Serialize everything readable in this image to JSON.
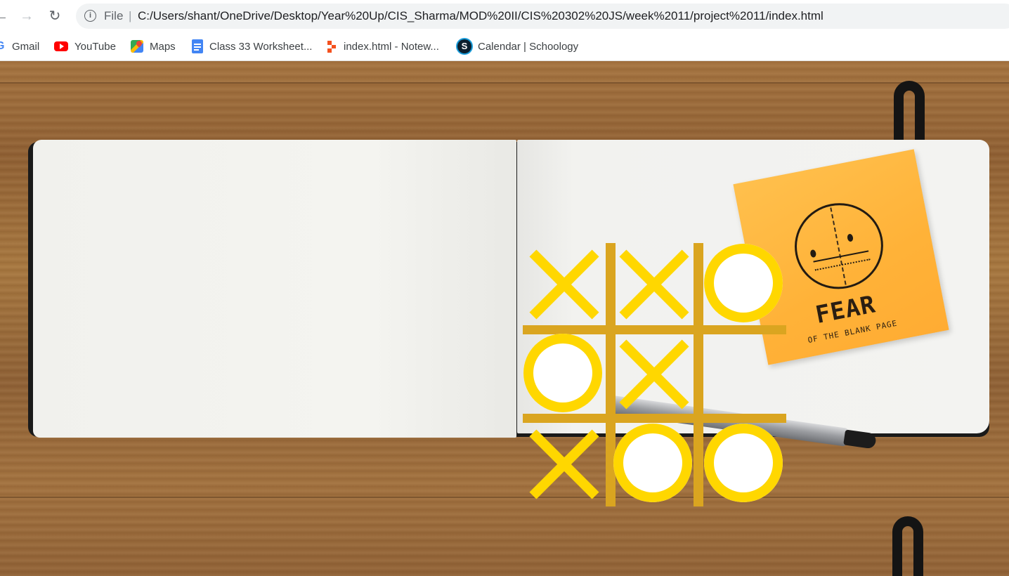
{
  "browser": {
    "url_scheme": "File",
    "url_separator": "|",
    "url": "C:/Users/shant/OneDrive/Desktop/Year%20Up/CIS_Sharma/MOD%20II/CIS%20302%20JS/week%2011/project%2011/index.html"
  },
  "bookmarks": [
    {
      "label": "Gmail",
      "icon": "google-g-icon"
    },
    {
      "label": "YouTube",
      "icon": "youtube-icon"
    },
    {
      "label": "Maps",
      "icon": "maps-icon"
    },
    {
      "label": "Class 33 Worksheet...",
      "icon": "google-docs-icon"
    },
    {
      "label": "index.html - Notew...",
      "icon": "notewriter-icon"
    },
    {
      "label": "Calendar | Schoology",
      "icon": "schoology-icon"
    }
  ],
  "background": {
    "sticky_note_title": "FEAR",
    "sticky_note_subtitle": "OF THE BLANK PAGE"
  },
  "game": {
    "cells": [
      "X",
      "X",
      "O",
      "O",
      "X",
      "",
      "X",
      "O",
      "O"
    ],
    "colors": {
      "mark": "#ffd700",
      "grid": "#daa520",
      "o_fill": "#ffffff"
    }
  }
}
